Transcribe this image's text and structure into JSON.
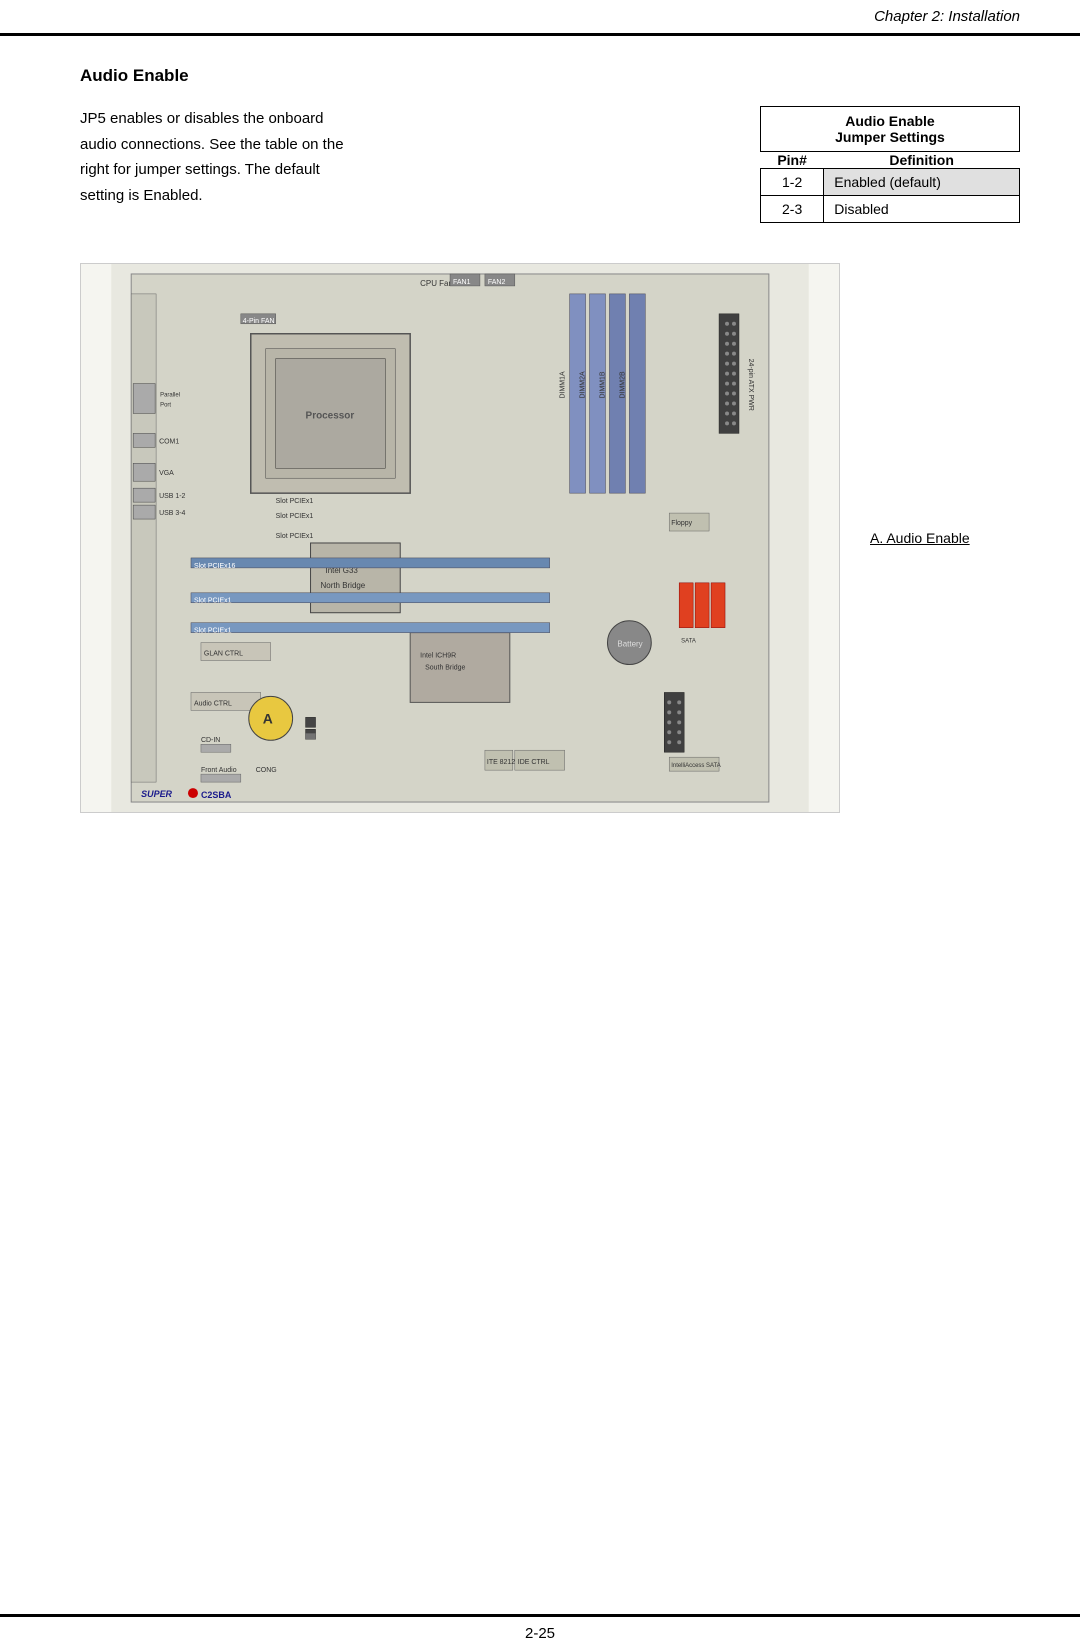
{
  "header": {
    "title": "Chapter 2: Installation"
  },
  "footer": {
    "page_number": "2-25"
  },
  "section": {
    "title": "Audio Enable",
    "description_line1": "JP5 enables or disables the onboard",
    "description_line2": "audio connections. See the table on the",
    "description_line3": "right for jumper settings. The default",
    "description_line4": "setting is Enabled."
  },
  "table": {
    "header_line1": "Audio Enable",
    "header_line2": "Jumper Settings",
    "col1_header": "Pin#",
    "col2_header": "Definition",
    "rows": [
      {
        "pin": "1-2",
        "definition": "Enabled (default)",
        "highlighted": true
      },
      {
        "pin": "2-3",
        "definition": "Disabled",
        "highlighted": false
      }
    ]
  },
  "diagram": {
    "caption": "A. Audio Enable",
    "super_prefix": "SUPER",
    "board_name": "C2SBA",
    "labels": {
      "cpu_fan": "CPU Fan",
      "fan1": "FAN1",
      "fan2": "FAN2",
      "processor": "Processor",
      "north_bridge": "North Bridge",
      "intel_g33": "Intel G33",
      "south_bridge": "Intel ICH9R South Bridge",
      "glan_ctrl": "GLAN CTRL",
      "audio_ctrl": "Audio CTRL",
      "cd_in": "CD-IN",
      "front_audio": "Front Audio",
      "cong": "CONG",
      "slot_pcie_x1_1": "Slot PCIEx1",
      "slot_pcie_x16": "Slot PCIEx16",
      "slot_pcie_x1_5": "Slot PCIEx1",
      "parallel_port": "Parallel Port",
      "vga": "VGA",
      "com1": "COM1",
      "usb12": "USB 12",
      "usb34": "USB 3-4",
      "battery": "Battery",
      "dimm1a": "DIMM1A",
      "dimm2a": "DIMM2A",
      "dimm1b": "DIMM1B",
      "dimm2b": "DIMM2B",
      "floppy": "Floppy",
      "cpu_fan_label": "4-Pin FAN"
    }
  }
}
